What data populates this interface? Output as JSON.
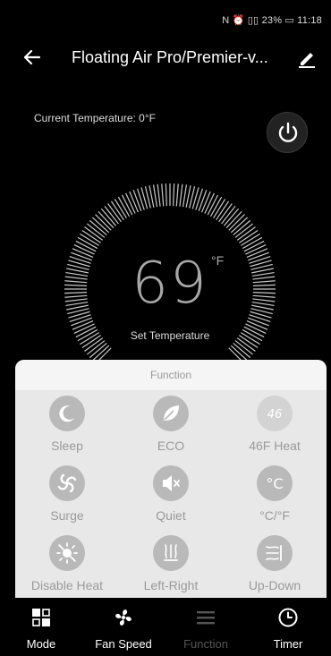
{
  "status_bar": {
    "text": "N ⏰ ▯▯ 23% ▭ 11:18"
  },
  "header": {
    "title": "Floating Air Pro/Premier-v...",
    "back_icon": "arrow-left-icon",
    "edit_icon": "pencil-icon"
  },
  "current_temperature": {
    "text": "Current Temperature: 0°F"
  },
  "power": {
    "icon": "power-icon"
  },
  "set_temperature": {
    "value": "69",
    "unit": "°F",
    "label": "Set Temperature"
  },
  "function_panel": {
    "title": "Function",
    "items": [
      {
        "label": "Sleep",
        "icon": "moon-icon"
      },
      {
        "label": "ECO",
        "icon": "leaf-icon"
      },
      {
        "label": "46F Heat",
        "icon": "46-badge-icon",
        "badge": "46"
      },
      {
        "label": "Surge",
        "icon": "swirl-icon"
      },
      {
        "label": "Quiet",
        "icon": "speaker-mute-icon"
      },
      {
        "label": "°C/°F",
        "icon": "celsius-icon",
        "badge": "°C"
      },
      {
        "label": "Disable Heat",
        "icon": "sun-off-icon"
      },
      {
        "label": "Left-Right",
        "icon": "swing-left-right-icon"
      },
      {
        "label": "Up-Down",
        "icon": "swing-up-down-icon"
      }
    ]
  },
  "bottom_nav": {
    "items": [
      {
        "label": "Mode",
        "icon": "mode-grid-icon",
        "active": true
      },
      {
        "label": "Fan Speed",
        "icon": "fan-icon",
        "active": true
      },
      {
        "label": "Function",
        "icon": "menu-icon",
        "active": false
      },
      {
        "label": "Timer",
        "icon": "clock-icon",
        "active": true
      }
    ]
  },
  "colors": {
    "background": "#000000",
    "panel": "#e8e8e8",
    "icon_circle": "#b9b9b9",
    "muted_text": "#9a9a9a"
  }
}
